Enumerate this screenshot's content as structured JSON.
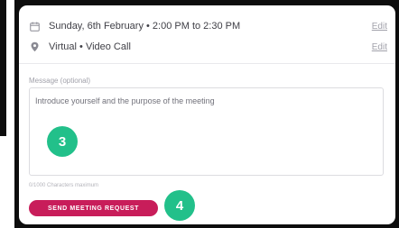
{
  "meeting": {
    "datetime": "Sunday, 6th February • 2:00 PM to 2:30 PM",
    "location": "Virtual • Video Call",
    "edit_label": "Edit"
  },
  "message": {
    "label": "Message (optional)",
    "placeholder": "Introduce yourself and the purpose of the meeting",
    "counter": "0/1000 Characters maximum"
  },
  "actions": {
    "send_label": "SEND MEETING REQUEST"
  },
  "annotations": {
    "step_textarea": "3",
    "step_button": "4"
  },
  "colors": {
    "accent": "#c81d5a",
    "badge": "#22c08a"
  },
  "icons": {
    "datetime": "calendar-icon",
    "location": "location-pin-icon"
  }
}
